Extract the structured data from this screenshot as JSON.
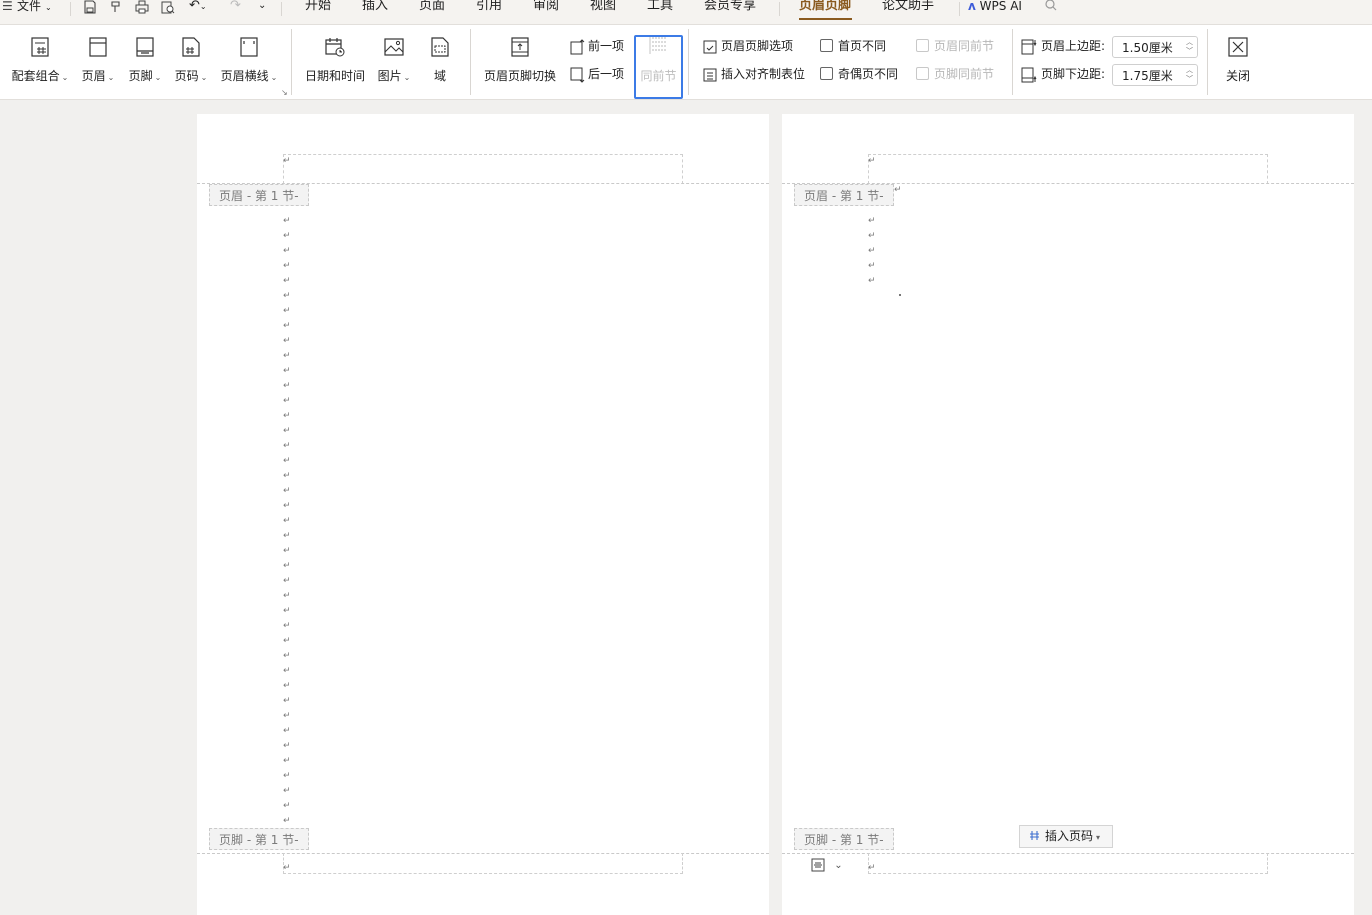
{
  "tabbar": {
    "menu_icon": "hamburger-icon",
    "file_label": "文件",
    "tabs": [
      "开始",
      "插入",
      "页面",
      "引用",
      "审阅",
      "视图",
      "工具",
      "会员专享",
      "页眉页脚",
      "论文助手"
    ],
    "active_tab": "页眉页脚",
    "wps_ai_label": "WPS AI",
    "accent_color": "#8a5a1f"
  },
  "ribbon": {
    "group1": {
      "combo": "配套组合",
      "header": "页眉",
      "footer": "页脚",
      "page_number": "页码",
      "header_line": "页眉横线"
    },
    "group2": {
      "datetime": "日期和时间",
      "picture": "图片",
      "field": "域"
    },
    "group3": {
      "switch": "页眉页脚切换",
      "prev": "前一项",
      "next": "后一项",
      "same_as_prev": "同前节"
    },
    "group4": {
      "options": "页眉页脚选项",
      "insert_align_tab": "插入对齐制表位",
      "first_page_diff": "首页不同",
      "odd_even_diff": "奇偶页不同",
      "header_same_prev": "页眉同前节",
      "footer_same_prev": "页脚同前节"
    },
    "group5": {
      "header_top_label": "页眉上边距:",
      "header_top_value": "1.50厘米",
      "footer_bottom_label": "页脚下边距:",
      "footer_bottom_value": "1.75厘米"
    },
    "close": "关闭",
    "selection_color": "#3c7be6"
  },
  "document": {
    "header_label": "页眉  - 第 1 节-",
    "footer_label": "页脚  - 第 1 节-",
    "paragraph_mark": "↵",
    "insert_page_number": "插入页码"
  }
}
